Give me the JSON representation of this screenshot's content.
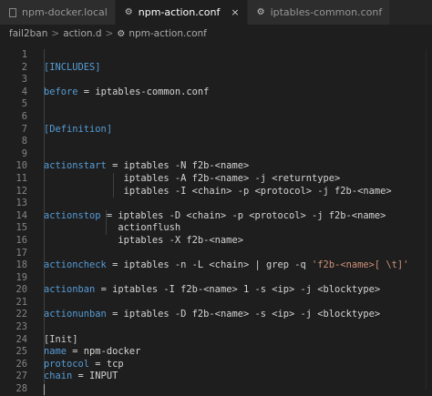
{
  "tabs": [
    {
      "label": "npm-docker.local",
      "icon": "file-icon",
      "active": false
    },
    {
      "label": "npm-action.conf",
      "icon": "gear-icon",
      "active": true
    },
    {
      "label": "iptables-common.conf",
      "icon": "gear-icon",
      "active": false
    }
  ],
  "close_glyph": "×",
  "breadcrumb": {
    "items": [
      "fail2ban",
      "action.d",
      "npm-action.conf"
    ],
    "separator": ">",
    "file_icon": "gear-icon"
  },
  "line_numbers": [
    "1",
    "2",
    "3",
    "4",
    "5",
    "6",
    "7",
    "8",
    "9",
    "10",
    "11",
    "12",
    "13",
    "14",
    "15",
    "16",
    "17",
    "18",
    "19",
    "20",
    "21",
    "22",
    "23",
    "24",
    "25",
    "26",
    "27",
    "28"
  ],
  "code_lines": [
    [],
    [
      {
        "t": "[INCLUDES]",
        "c": "k"
      }
    ],
    [],
    [
      {
        "t": "before",
        "c": "k"
      },
      {
        "t": " = iptables-common.conf",
        "c": "p"
      }
    ],
    [],
    [],
    [
      {
        "t": "[Definition]",
        "c": "k"
      }
    ],
    [],
    [],
    [
      {
        "t": "actionstart",
        "c": "k"
      },
      {
        "t": " = iptables -N f2b-<name>",
        "c": "p"
      }
    ],
    [
      {
        "t": "              iptables -A f2b-<name> -j <returntype>",
        "c": "p"
      }
    ],
    [
      {
        "t": "              iptables -I <chain> -p <protocol> -j f2b-<name>",
        "c": "p"
      }
    ],
    [],
    [
      {
        "t": "actionstop",
        "c": "k"
      },
      {
        "t": " = iptables -D <chain> -p <protocol> -j f2b-<name>",
        "c": "p"
      }
    ],
    [
      {
        "t": "             actionflush",
        "c": "p"
      }
    ],
    [
      {
        "t": "             iptables -X f2b-<name>",
        "c": "p"
      }
    ],
    [],
    [
      {
        "t": "actioncheck",
        "c": "k"
      },
      {
        "t": " = iptables -n -L <chain> | grep -q ",
        "c": "p"
      },
      {
        "t": "'f2b-<name>[ \\t]'",
        "c": "s"
      }
    ],
    [],
    [
      {
        "t": "actionban",
        "c": "k"
      },
      {
        "t": " = iptables -I f2b-<name> 1 -s <ip> -j <blocktype>",
        "c": "p"
      }
    ],
    [],
    [
      {
        "t": "actionunban",
        "c": "k"
      },
      {
        "t": " = iptables -D f2b-<name> -s <ip> -j <blocktype>",
        "c": "p"
      }
    ],
    [],
    [
      {
        "t": "[Init]",
        "c": "w"
      }
    ],
    [
      {
        "t": "name",
        "c": "k"
      },
      {
        "t": " = npm-docker",
        "c": "p"
      }
    ],
    [
      {
        "t": "protocol",
        "c": "k"
      },
      {
        "t": " = tcp",
        "c": "p"
      }
    ],
    [
      {
        "t": "chain",
        "c": "k"
      },
      {
        "t": " = INPUT",
        "c": "p"
      }
    ],
    []
  ],
  "colors": {
    "background": "#1e1e1e",
    "key": "#569cd6",
    "plain": "#d4d4d4",
    "string": "#ce9178",
    "line_number": "#858585"
  },
  "cursor_line": "28"
}
